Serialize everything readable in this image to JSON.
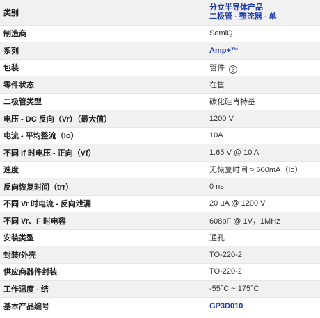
{
  "header": {
    "label": "类别",
    "value_line1": "分立半导体产品",
    "value_line2": "二极管 - 整流器 - 单"
  },
  "rows": [
    {
      "key": "制造商",
      "value": "SemiQ"
    },
    {
      "key": "系列",
      "value": "Amp+™"
    },
    {
      "key": "包装",
      "value": "管件"
    },
    {
      "key": "零件状态",
      "value": "在售"
    },
    {
      "key": "二极管类型",
      "value": "碳化硅肖特基"
    },
    {
      "key": "电压 - DC 反向（Vr）（最大值）",
      "value": "1200 V"
    },
    {
      "key": "电流 - 平均整流（Io）",
      "value": "10A"
    },
    {
      "key": "不同 If 时电压 - 正向（Vf）",
      "value": "1.65 V @ 10 A"
    },
    {
      "key": "速度",
      "value": "无恢复时间 > 500mA（Io）"
    },
    {
      "key": "反向恢复时间（trr）",
      "value": "0 ns"
    },
    {
      "key": "不同 Vr 时电流 - 反向泄漏",
      "value": "20 µA @ 1200 V"
    },
    {
      "key": "不同 Vr、F 时电容",
      "value": "608pF @ 1V，1MHz"
    },
    {
      "key": "安装类型",
      "value": "通孔"
    },
    {
      "key": "封装/外壳",
      "value": "TO-220-2"
    },
    {
      "key": "供应商器件封装",
      "value": "TO-220-2"
    },
    {
      "key": "工作温度 - 结",
      "value": "-55°C ~ 175°C"
    },
    {
      "key": "基本产品编号",
      "value": "GP3D010"
    }
  ],
  "help_icon": {
    "name": "question-circle-icon",
    "glyph": "?"
  },
  "colors": {
    "link": "#1d3ba8",
    "row_alt": "#f1f1f1",
    "border": "#e6e6e6"
  }
}
